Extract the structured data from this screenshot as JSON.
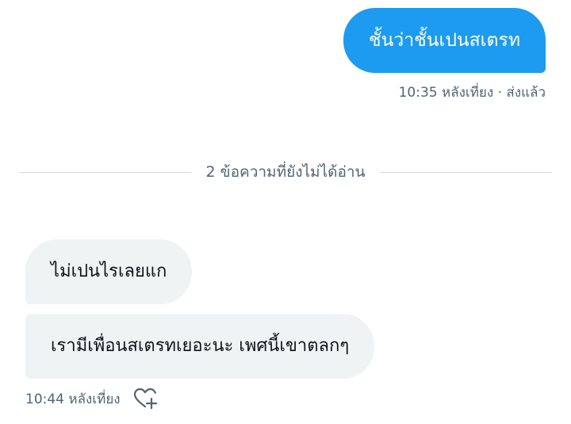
{
  "outgoing": {
    "message": "ชั้นว่าชั้นเปนสเตรท",
    "timestamp": "10:35 หลังเที่ยง · ส่งแล้ว"
  },
  "divider": {
    "label": "2 ข้อความที่ยังไม่ได้อ่าน"
  },
  "incoming": {
    "messages": [
      "ไม่เปนไรเลยแก",
      "เรามีเพื่อนสเตรทเยอะนะ เพศนี้เขาตลกๆ"
    ],
    "timestamp": "10:44 หลังเที่ยง",
    "react_icon": "heart-plus-icon"
  },
  "colors": {
    "outgoing_bubble": "#1d9bf0",
    "incoming_bubble": "#eff3f4",
    "meta_text": "#536471",
    "divider_line": "#cfd9de"
  }
}
